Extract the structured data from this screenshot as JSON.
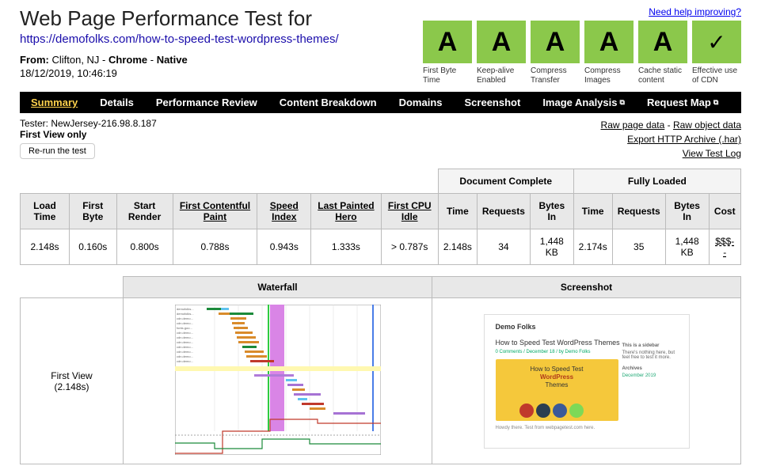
{
  "help_link": "Need help improving?",
  "page_title": "Web Page Performance Test for",
  "tested_url": "https://demofolks.com/how-to-speed-test-wordpress-themes/",
  "from_label": "From:",
  "from_location": "Clifton, NJ",
  "from_browser": "Chrome",
  "from_native": "Native",
  "test_datetime": "18/12/2019, 10:46:19",
  "grades": [
    {
      "grade": "A",
      "label": "First Byte Time",
      "class": "grade-a"
    },
    {
      "grade": "A",
      "label": "Keep-alive Enabled",
      "class": "grade-a"
    },
    {
      "grade": "A",
      "label": "Compress Transfer",
      "class": "grade-a"
    },
    {
      "grade": "A",
      "label": "Compress Images",
      "class": "grade-a"
    },
    {
      "grade": "A",
      "label": "Cache static content",
      "class": "grade-a"
    },
    {
      "grade": "✓",
      "label": "Effective use of CDN",
      "class": "grade-a grade-check"
    }
  ],
  "nav": {
    "summary": "Summary",
    "details": "Details",
    "perf": "Performance Review",
    "breakdown": "Content Breakdown",
    "domains": "Domains",
    "screenshot": "Screenshot",
    "image": "Image Analysis",
    "reqmap": "Request Map"
  },
  "tester_label": "Tester:",
  "tester_value": "NewJersey-216.98.8.187",
  "first_view_only": "First View only",
  "rerun": "Re-run the test",
  "raw_page": "Raw page data",
  "raw_object": "Raw object data",
  "export_har": "Export HTTP Archive (.har)",
  "view_log": "View Test Log",
  "metrics": {
    "group_doc": "Document Complete",
    "group_full": "Fully Loaded",
    "h_load": "Load Time",
    "h_fb": "First Byte",
    "h_sr": "Start Render",
    "h_fcp": "First Contentful Paint",
    "h_si": "Speed Index",
    "h_lph": "Last Painted Hero",
    "h_fci": "First CPU Idle",
    "h_time": "Time",
    "h_req": "Requests",
    "h_bytes": "Bytes In",
    "h_cost": "Cost",
    "v_load": "2.148s",
    "v_fb": "0.160s",
    "v_sr": "0.800s",
    "v_fcp": "0.788s",
    "v_si": "0.943s",
    "v_lph": "1.333s",
    "v_fci": "> 0.787s",
    "dc_time": "2.148s",
    "dc_req": "34",
    "dc_bytes": "1,448 KB",
    "fl_time": "2.174s",
    "fl_req": "35",
    "fl_bytes": "1,448 KB",
    "fl_cost": "$$$--"
  },
  "wf": {
    "h_waterfall": "Waterfall",
    "h_screenshot": "Screenshot",
    "row_label_1": "First View",
    "row_label_2": "(2.148s)",
    "ss_logo": "Demo Folks",
    "ss_heading": "How to Speed Test WordPress Themes",
    "ss_hero_1": "How to Speed Test",
    "ss_hero_2": "WordPress",
    "ss_hero_3": "Themes",
    "ss_side_h": "This is a sidebar",
    "ss_side_t": "There's nothing here, but feel free to test it more.",
    "ss_arch": "Archives"
  }
}
